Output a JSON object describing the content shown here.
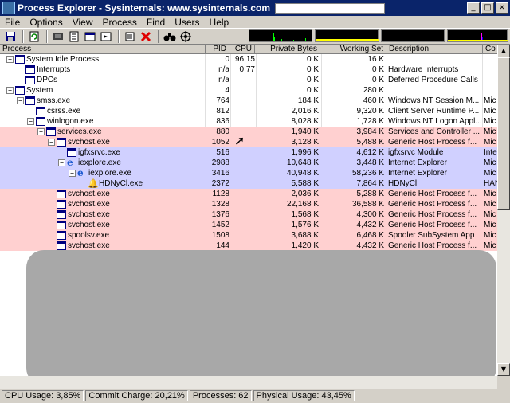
{
  "window": {
    "title": "Process Explorer - Sysinternals: www.sysinternals.com",
    "minimize": "_",
    "maximize": "□",
    "close": "×"
  },
  "menu": [
    "File",
    "Options",
    "View",
    "Process",
    "Find",
    "Users",
    "Help"
  ],
  "toolbar": {
    "icons": [
      "save-icon",
      "refresh-icon",
      "system-info-icon",
      "properties-icon",
      "window-icon",
      "handles-icon",
      "dll-icon",
      "kill-icon",
      "find-icon",
      "target-icon"
    ]
  },
  "columns": {
    "process": "Process",
    "pid": "PID",
    "cpu": "CPU",
    "private_bytes": "Private Bytes",
    "working_set": "Working Set",
    "description": "Description",
    "company": "Co"
  },
  "processes": [
    {
      "name": "System Idle Process",
      "pid": "0",
      "cpu": "96,15",
      "priv": "0 K",
      "ws": "16 K",
      "desc": "",
      "co": "",
      "level": 0,
      "expand": "−",
      "style": "normal",
      "icon": "process-icon"
    },
    {
      "name": "Interrupts",
      "pid": "n/a",
      "cpu": "0,77",
      "priv": "0 K",
      "ws": "0 K",
      "desc": "Hardware Interrupts",
      "co": "",
      "level": 1,
      "expand": "",
      "style": "normal",
      "icon": "process-icon"
    },
    {
      "name": "DPCs",
      "pid": "n/a",
      "cpu": "",
      "priv": "0 K",
      "ws": "0 K",
      "desc": "Deferred Procedure Calls",
      "co": "",
      "level": 1,
      "expand": "",
      "style": "normal",
      "icon": "process-icon"
    },
    {
      "name": "System",
      "pid": "4",
      "cpu": "",
      "priv": "0 K",
      "ws": "280 K",
      "desc": "",
      "co": "",
      "level": 0,
      "expand": "−",
      "style": "normal",
      "icon": "process-icon"
    },
    {
      "name": "smss.exe",
      "pid": "764",
      "cpu": "",
      "priv": "184 K",
      "ws": "460 K",
      "desc": "Windows NT Session M...",
      "co": "Mic",
      "level": 1,
      "expand": "−",
      "style": "normal",
      "icon": "process-icon"
    },
    {
      "name": "csrss.exe",
      "pid": "812",
      "cpu": "",
      "priv": "2,016 K",
      "ws": "9,320 K",
      "desc": "Client Server Runtime P...",
      "co": "Mic",
      "level": 2,
      "expand": "",
      "style": "normal",
      "icon": "process-icon"
    },
    {
      "name": "winlogon.exe",
      "pid": "836",
      "cpu": "",
      "priv": "8,028 K",
      "ws": "1,728 K",
      "desc": "Windows NT Logon Appl...",
      "co": "Mic",
      "level": 2,
      "expand": "−",
      "style": "normal",
      "icon": "process-icon"
    },
    {
      "name": "services.exe",
      "pid": "880",
      "cpu": "",
      "priv": "1,940 K",
      "ws": "3,984 K",
      "desc": "Services and Controller ...",
      "co": "Mic",
      "level": 3,
      "expand": "−",
      "style": "services",
      "icon": "process-icon"
    },
    {
      "name": "svchost.exe",
      "pid": "1052",
      "cpu": "",
      "priv": "3,128 K",
      "ws": "5,488 K",
      "desc": "Generic Host Process f...",
      "co": "Mic",
      "level": 4,
      "expand": "−",
      "style": "services",
      "icon": "process-icon"
    },
    {
      "name": "igfxsrvc.exe",
      "pid": "516",
      "cpu": "",
      "priv": "1,996 K",
      "ws": "4,612 K",
      "desc": "igfxsrvc Module",
      "co": "Inte",
      "level": 5,
      "expand": "",
      "style": "own",
      "icon": "process-icon"
    },
    {
      "name": "iexplore.exe",
      "pid": "2988",
      "cpu": "",
      "priv": "10,648 K",
      "ws": "3,448 K",
      "desc": "Internet Explorer",
      "co": "Mic",
      "level": 5,
      "expand": "−",
      "style": "own",
      "icon": "ie-icon"
    },
    {
      "name": "iexplore.exe",
      "pid": "3416",
      "cpu": "",
      "priv": "40,948 K",
      "ws": "58,236 K",
      "desc": "Internet Explorer",
      "co": "Mic",
      "level": 6,
      "expand": "−",
      "style": "own",
      "icon": "ie-icon"
    },
    {
      "name": "HDNyCl.exe",
      "pid": "2372",
      "cpu": "",
      "priv": "5,588 K",
      "ws": "7,864 K",
      "desc": "HDNyCl",
      "co": "HAN",
      "level": 7,
      "expand": "",
      "style": "own",
      "icon": "bell-icon"
    },
    {
      "name": "svchost.exe",
      "pid": "1128",
      "cpu": "",
      "priv": "2,036 K",
      "ws": "5,288 K",
      "desc": "Generic Host Process f...",
      "co": "Mic",
      "level": 4,
      "expand": "",
      "style": "services",
      "icon": "process-icon"
    },
    {
      "name": "svchost.exe",
      "pid": "1328",
      "cpu": "",
      "priv": "22,168 K",
      "ws": "36,588 K",
      "desc": "Generic Host Process f...",
      "co": "Mic",
      "level": 4,
      "expand": "",
      "style": "services",
      "icon": "process-icon"
    },
    {
      "name": "svchost.exe",
      "pid": "1376",
      "cpu": "",
      "priv": "1,568 K",
      "ws": "4,300 K",
      "desc": "Generic Host Process f...",
      "co": "Mic",
      "level": 4,
      "expand": "",
      "style": "services",
      "icon": "process-icon"
    },
    {
      "name": "svchost.exe",
      "pid": "1452",
      "cpu": "",
      "priv": "1,576 K",
      "ws": "4,432 K",
      "desc": "Generic Host Process f...",
      "co": "Mic",
      "level": 4,
      "expand": "",
      "style": "services",
      "icon": "process-icon"
    },
    {
      "name": "spoolsv.exe",
      "pid": "1508",
      "cpu": "",
      "priv": "3,688 K",
      "ws": "6,468 K",
      "desc": "Spooler SubSystem App",
      "co": "Mic",
      "level": 4,
      "expand": "",
      "style": "services",
      "icon": "process-icon"
    },
    {
      "name": "svchost.exe",
      "pid": "144",
      "cpu": "",
      "priv": "1,420 K",
      "ws": "4,432 K",
      "desc": "Generic Host Process f...",
      "co": "Mic",
      "level": 4,
      "expand": "",
      "style": "services",
      "icon": "process-icon"
    }
  ],
  "status": {
    "cpu_usage": "CPU Usage: 3,85%",
    "commit_charge": "Commit Charge: 20,21%",
    "processes": "Processes: 62",
    "physical_usage": "Physical Usage: 43,45%"
  }
}
